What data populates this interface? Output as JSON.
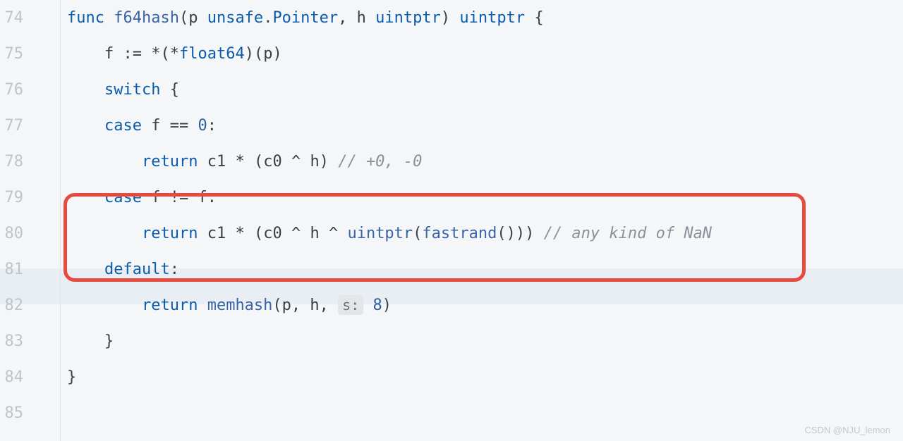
{
  "watermark": "CSDN @NJU_lemon",
  "lines": [
    {
      "num": "74",
      "indent": 0
    },
    {
      "num": "75",
      "indent": 1
    },
    {
      "num": "76",
      "indent": 1
    },
    {
      "num": "77",
      "indent": 1
    },
    {
      "num": "78",
      "indent": 2
    },
    {
      "num": "79",
      "indent": 1
    },
    {
      "num": "80",
      "indent": 2
    },
    {
      "num": "81",
      "indent": 1
    },
    {
      "num": "82",
      "indent": 2
    },
    {
      "num": "83",
      "indent": 1
    },
    {
      "num": "84",
      "indent": 0
    },
    {
      "num": "85",
      "indent": 0
    }
  ],
  "tokens": {
    "l74": {
      "kw1": "func",
      "fn": "f64hash",
      "p1": "(",
      "a1": "p",
      "t1": "unsafe",
      "dot": ".",
      "t2": "Pointer",
      "c1": ",",
      "a2": "h",
      "t3": "uintptr",
      "p2": ")",
      "ret": "uintptr",
      "brace": "{"
    },
    "l75": {
      "id": "f",
      "op": ":=",
      "star1": "*",
      "p1": "(",
      "star2": "*",
      "type": "float64",
      "p2": ")",
      "p3": "(",
      "arg": "p",
      "p4": ")"
    },
    "l76": {
      "kw": "switch",
      "brace": "{"
    },
    "l77": {
      "kw": "case",
      "id": "f",
      "op": "==",
      "num": "0",
      "colon": ":"
    },
    "l78": {
      "kw": "return",
      "c1": "c1",
      "op1": "*",
      "p1": "(",
      "c0": "c0",
      "op2": "^",
      "h": "h",
      "p2": ")",
      "comment": "// +0, -0"
    },
    "l79": {
      "kw": "case",
      "f1": "f",
      "op": "!=",
      "f2": "f",
      "colon": ":"
    },
    "l80": {
      "kw": "return",
      "c1": "c1",
      "op1": "*",
      "p1": "(",
      "c0": "c0",
      "op2": "^",
      "h": "h",
      "op3": "^",
      "fn1": "uintptr",
      "p2": "(",
      "fn2": "fastrand",
      "p3": "(",
      "p4": ")",
      "p5": ")",
      "p6": ")",
      "comment": "// any kind of NaN"
    },
    "l81": {
      "kw": "default",
      "colon": ":"
    },
    "l82": {
      "kw": "return",
      "fn": "memhash",
      "p1": "(",
      "a1": "p",
      "c1": ",",
      "a2": "h",
      "c2": ",",
      "hint": "s:",
      "num": "8",
      "p2": ")"
    },
    "l83": {
      "brace": "}"
    },
    "l84": {
      "brace": "}"
    }
  }
}
